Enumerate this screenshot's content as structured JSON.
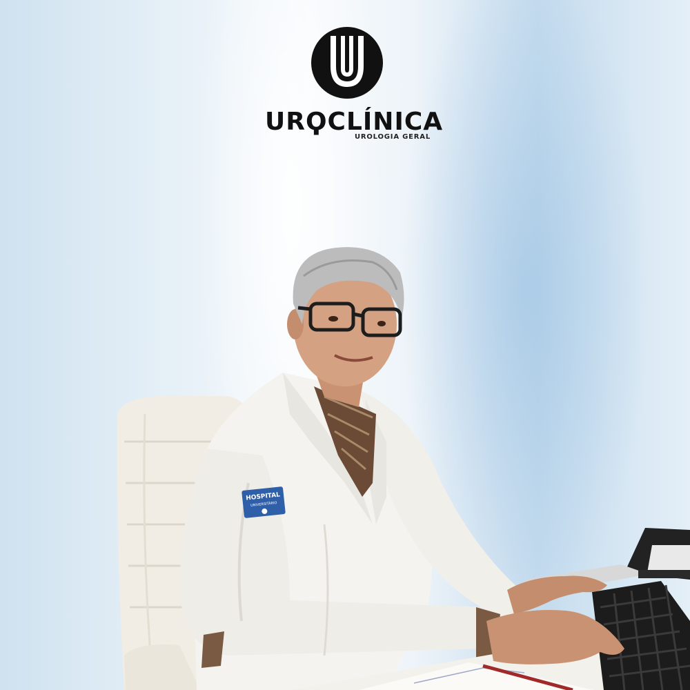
{
  "logo": {
    "wordmark": "URϘCLÍNICA",
    "tagline": "UROLOGIA GERAL"
  },
  "sleeve_patch": {
    "line1": "HOSPITAL",
    "line2": "UNIVERSITÁRIO"
  },
  "colors": {
    "logo": "#111111",
    "coat": "#f4f3ef",
    "chair": "#f1ede4",
    "background": "#e6f0f7"
  }
}
